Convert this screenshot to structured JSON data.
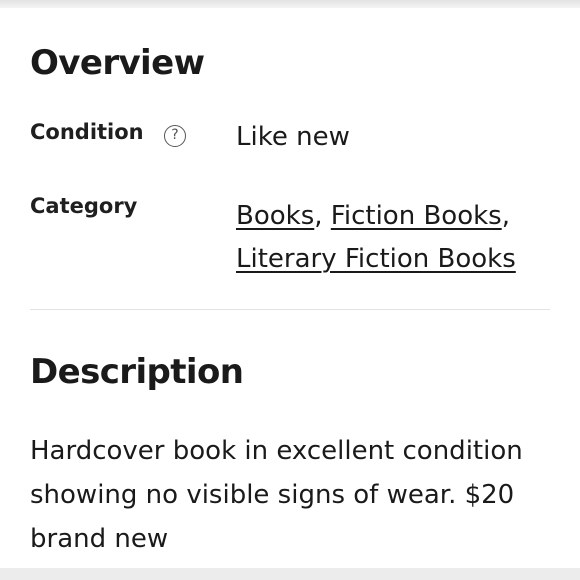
{
  "overview": {
    "title": "Overview",
    "condition": {
      "label": "Condition",
      "help_icon": "question-circle-icon",
      "value": "Like new"
    },
    "category": {
      "label": "Category",
      "links": [
        {
          "text": "Books",
          "separator": ", "
        },
        {
          "text": "Fiction Books",
          "separator": ","
        },
        {
          "text": "Literary Fiction Books",
          "separator": ""
        }
      ]
    }
  },
  "description": {
    "title": "Description",
    "text": "Hardcover book in excellent condition showing no visible signs of wear. $20 brand new"
  }
}
